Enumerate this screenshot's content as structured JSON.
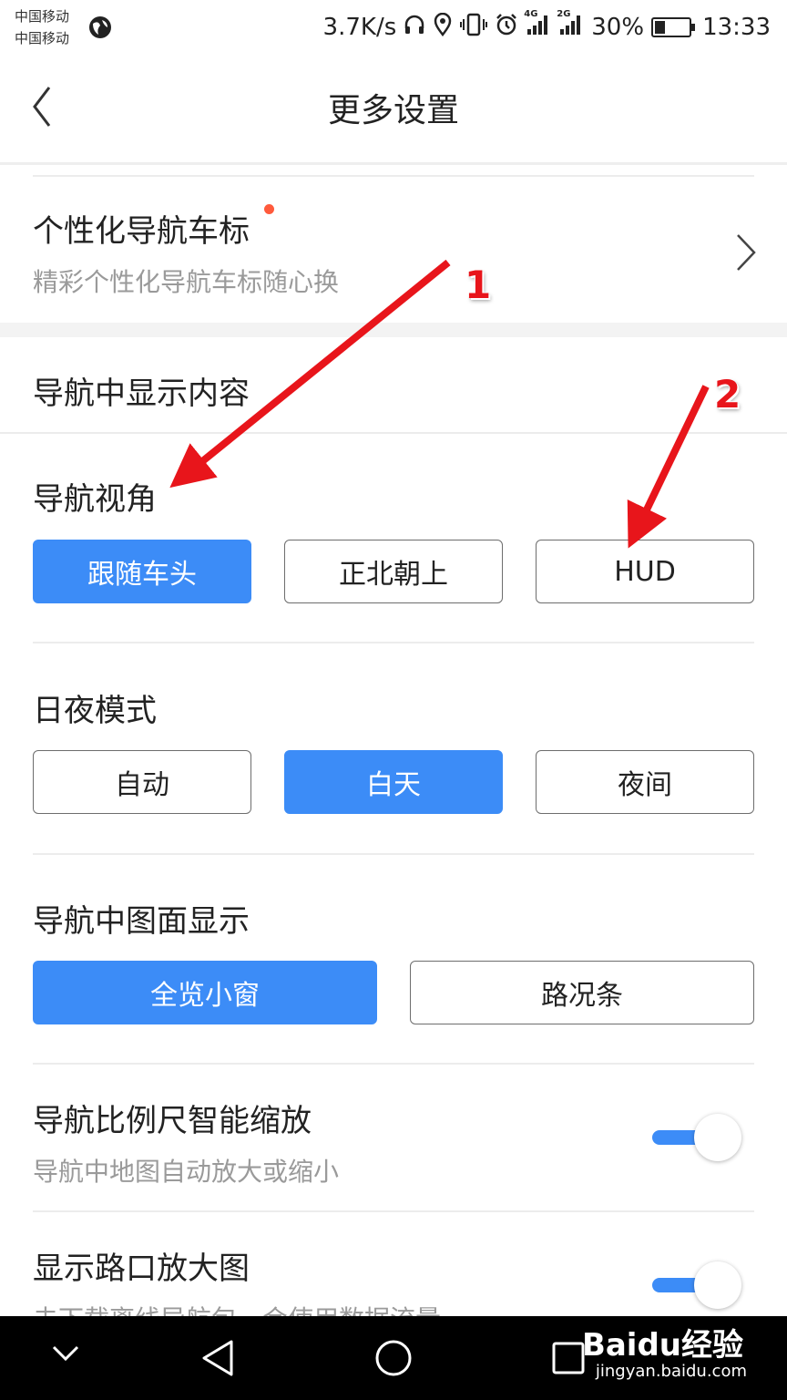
{
  "status_bar": {
    "carrier1": "中国移动",
    "carrier2": "中国移动",
    "speed": "3.7K/s",
    "signal1": "4G",
    "signal2": "2G",
    "battery": "30%",
    "battery_level": 0.3,
    "time": "13:33"
  },
  "header": {
    "title": "更多设置"
  },
  "car_icon": {
    "title": "个性化导航车标",
    "subtitle": "精彩个性化导航车标随心换"
  },
  "nav_display": {
    "section_title": "导航中显示内容",
    "view_angle": {
      "label": "导航视角",
      "options": [
        "跟随车头",
        "正北朝上",
        "HUD"
      ],
      "selected": "跟随车头"
    },
    "day_night": {
      "label": "日夜模式",
      "options": [
        "自动",
        "白天",
        "夜间"
      ],
      "selected": "白天"
    },
    "screen_display": {
      "label": "导航中图面显示",
      "options": [
        "全览小窗",
        "路况条"
      ],
      "selected": "全览小窗"
    }
  },
  "scale_zoom": {
    "title": "导航比例尺智能缩放",
    "subtitle": "导航中地图自动放大或缩小",
    "enabled": true
  },
  "junction_zoom": {
    "title": "显示路口放大图",
    "subtitle": "未下载离线导航包，会使用数据流量",
    "enabled": true
  },
  "annotations": {
    "arrow1": "1",
    "arrow2": "2"
  },
  "watermark": {
    "brand": "Baidu经验",
    "url": "jingyan.baidu.com"
  },
  "colors": {
    "accent": "#3c8cf7",
    "annotation": "#e8151b",
    "badge": "#ff5a3c"
  }
}
